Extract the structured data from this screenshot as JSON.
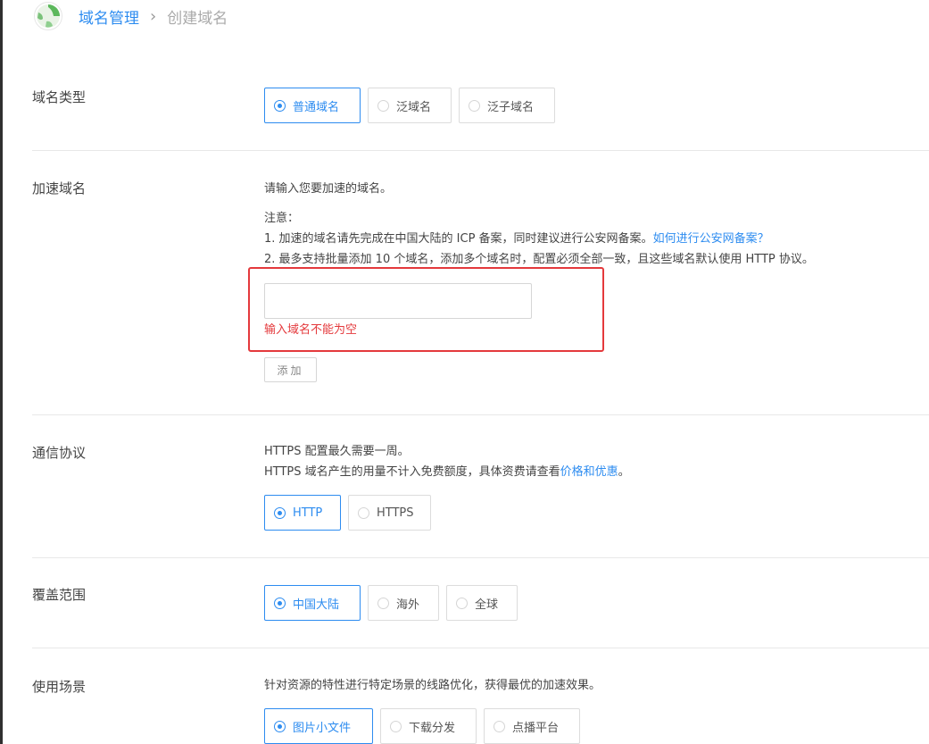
{
  "breadcrumb": {
    "parent": "域名管理",
    "separator": "›",
    "current": "创建域名"
  },
  "domain_type": {
    "label": "域名类型",
    "options": [
      {
        "text": "普通域名",
        "selected": true
      },
      {
        "text": "泛域名",
        "selected": false
      },
      {
        "text": "泛子域名",
        "selected": false
      }
    ]
  },
  "accel_domain": {
    "label": "加速域名",
    "intro": "请输入您要加速的域名。",
    "note_title": "注意：",
    "note1": "1. 加速的域名请先完成在中国大陆的 ICP 备案，同时建议进行公安网备案。",
    "note1_link": "如何进行公安网备案？",
    "note2": "2. 最多支持批量添加 10 个域名，添加多个域名时，配置必须全部一致，且这些域名默认使用 HTTP 协议。",
    "input_value": "",
    "error": "输入域名不能为空",
    "add_label": "添加"
  },
  "protocol": {
    "label": "通信协议",
    "line1": "HTTPS 配置最久需要一周。",
    "line2": "HTTPS 域名产生的用量不计入免费额度，具体资费请查看",
    "line2_link": "价格和优惠",
    "line2_end": "。",
    "options": [
      {
        "text": "HTTP",
        "selected": true
      },
      {
        "text": "HTTPS",
        "selected": false
      }
    ]
  },
  "coverage": {
    "label": "覆盖范围",
    "options": [
      {
        "text": "中国大陆",
        "selected": true
      },
      {
        "text": "海外",
        "selected": false
      },
      {
        "text": "全球",
        "selected": false
      }
    ]
  },
  "scenario": {
    "label": "使用场景",
    "desc": "针对资源的特性进行特定场景的线路优化，获得最优的加速效果。",
    "options": [
      {
        "text": "图片小文件",
        "selected": true
      },
      {
        "text": "下载分发",
        "selected": false
      },
      {
        "text": "点播平台",
        "selected": false
      }
    ]
  },
  "colors": {
    "accent": "#2d8cf0",
    "error": "#e4393c",
    "border": "#dcdcdc"
  },
  "icons": {
    "logo": "globe-logo-icon"
  }
}
